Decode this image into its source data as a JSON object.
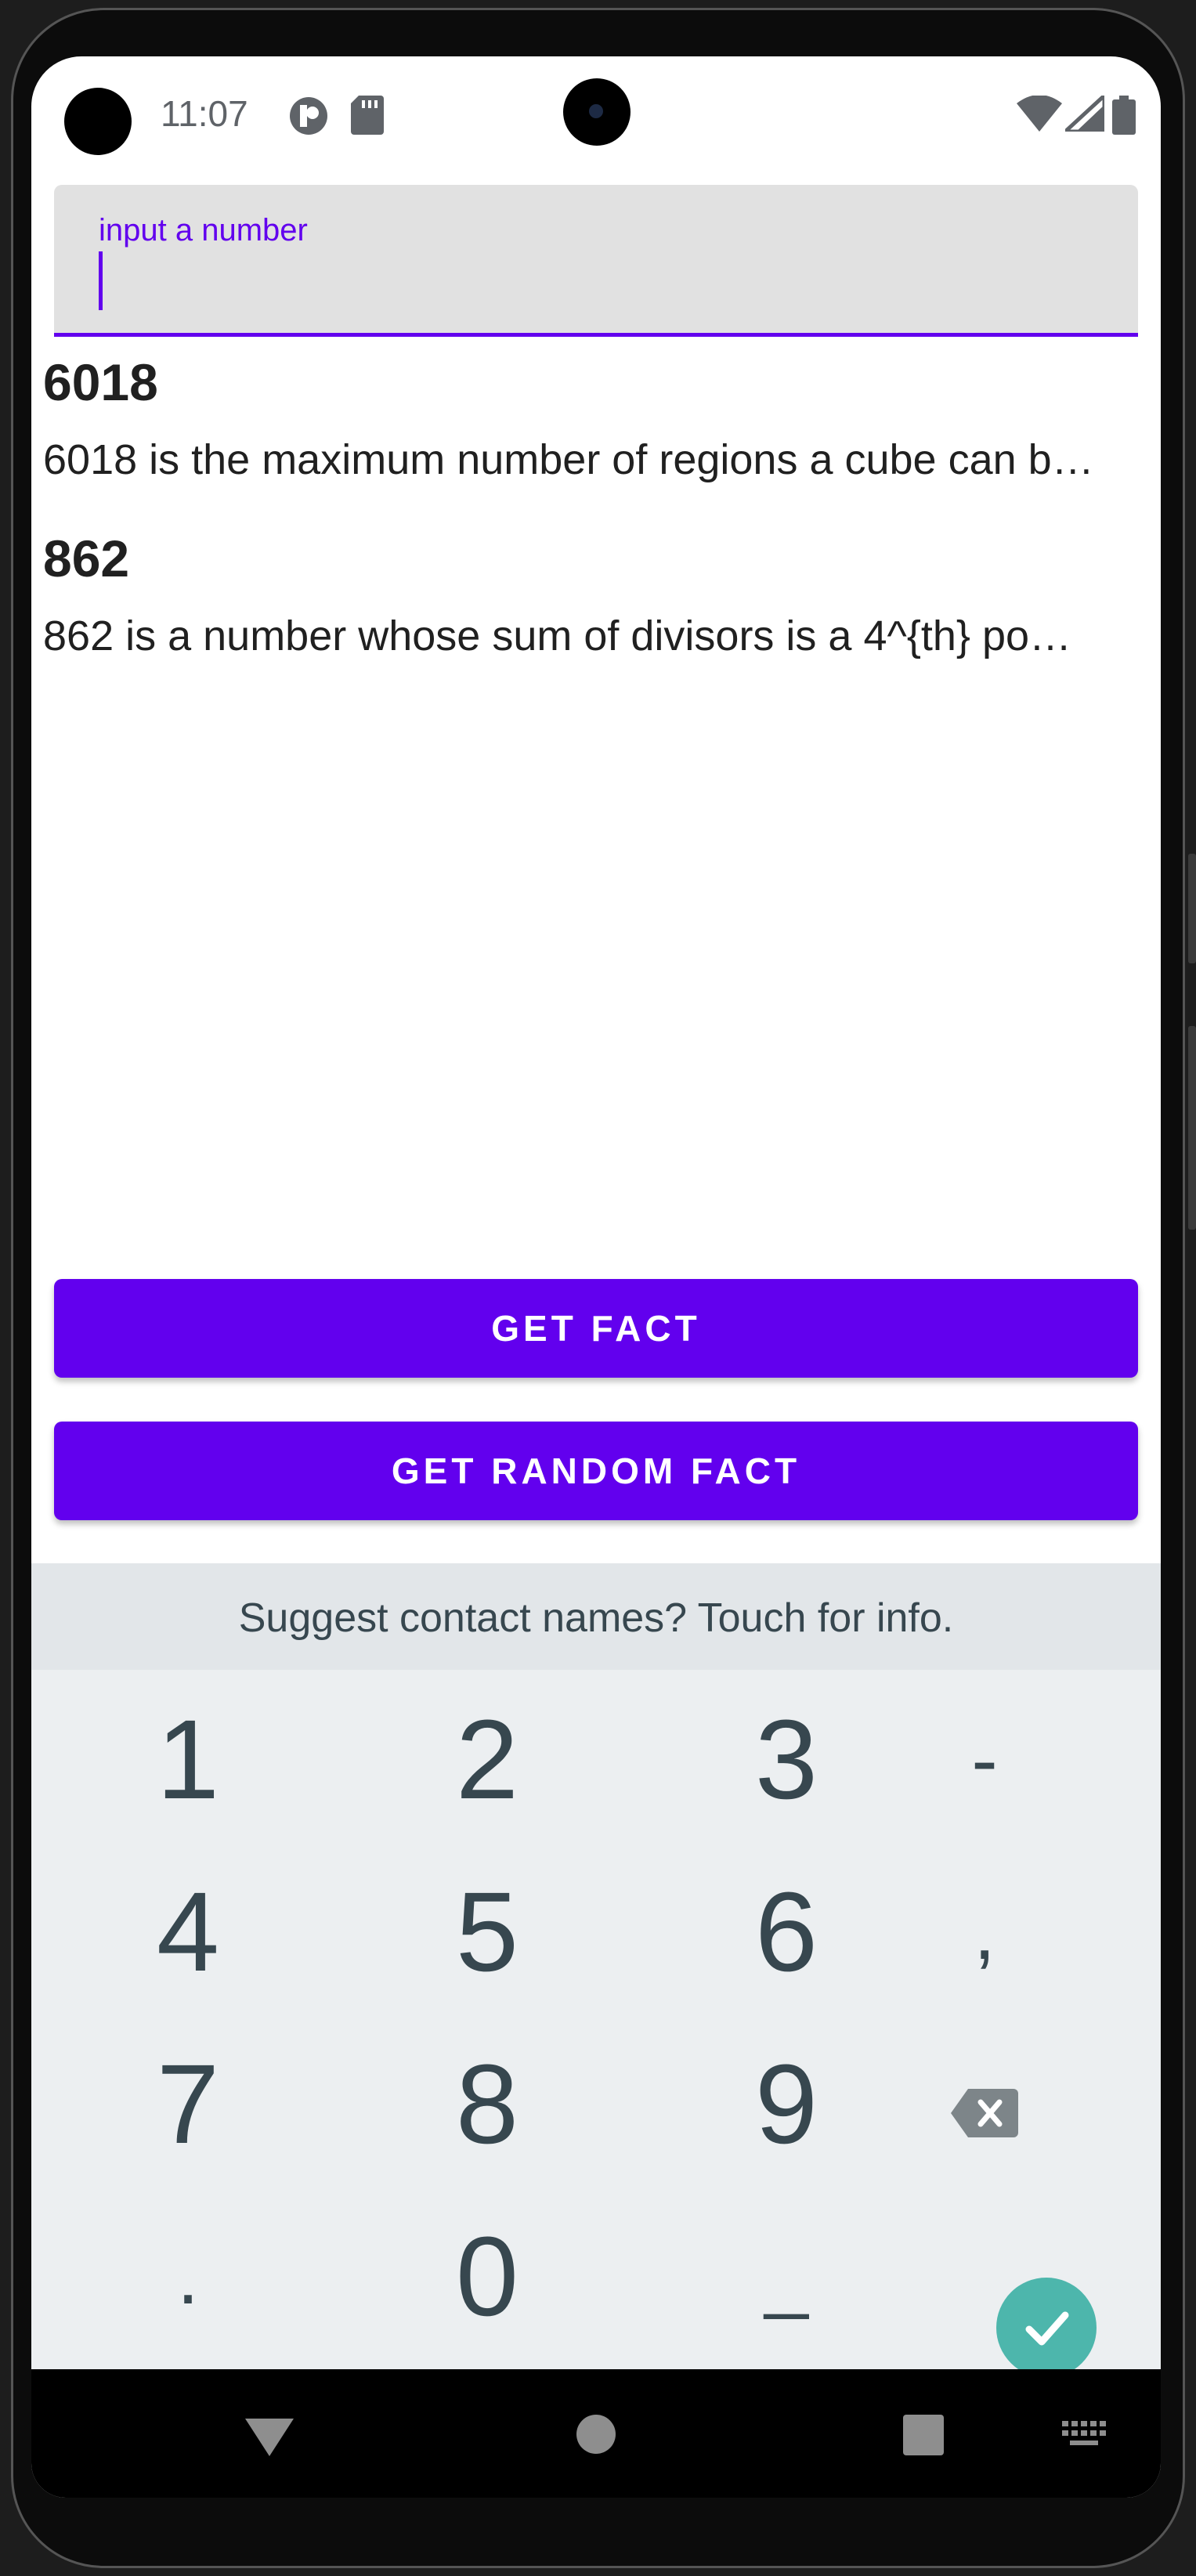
{
  "status_bar": {
    "time": "11:07",
    "icons": [
      "profile-badge-icon",
      "sd-card-icon",
      "wifi-icon",
      "cellular-icon",
      "battery-icon"
    ]
  },
  "input": {
    "label": "input a number",
    "value": ""
  },
  "facts": [
    {
      "number": "6018",
      "text": "6018 is the maximum number of regions a cube can b…"
    },
    {
      "number": "862",
      "text": "862 is a number whose sum of divisors is a 4^{th} po…"
    }
  ],
  "buttons": {
    "get_fact": "GET FACT",
    "get_random_fact": "GET RANDOM FACT"
  },
  "keyboard": {
    "suggestion": "Suggest contact names? Touch for info.",
    "keys": [
      "1",
      "2",
      "3",
      "-",
      "4",
      "5",
      "6",
      ",",
      "7",
      "8",
      "9",
      ".",
      "0",
      "_"
    ]
  },
  "colors": {
    "accent": "#6200ee",
    "enter_key": "#4db6ac"
  }
}
